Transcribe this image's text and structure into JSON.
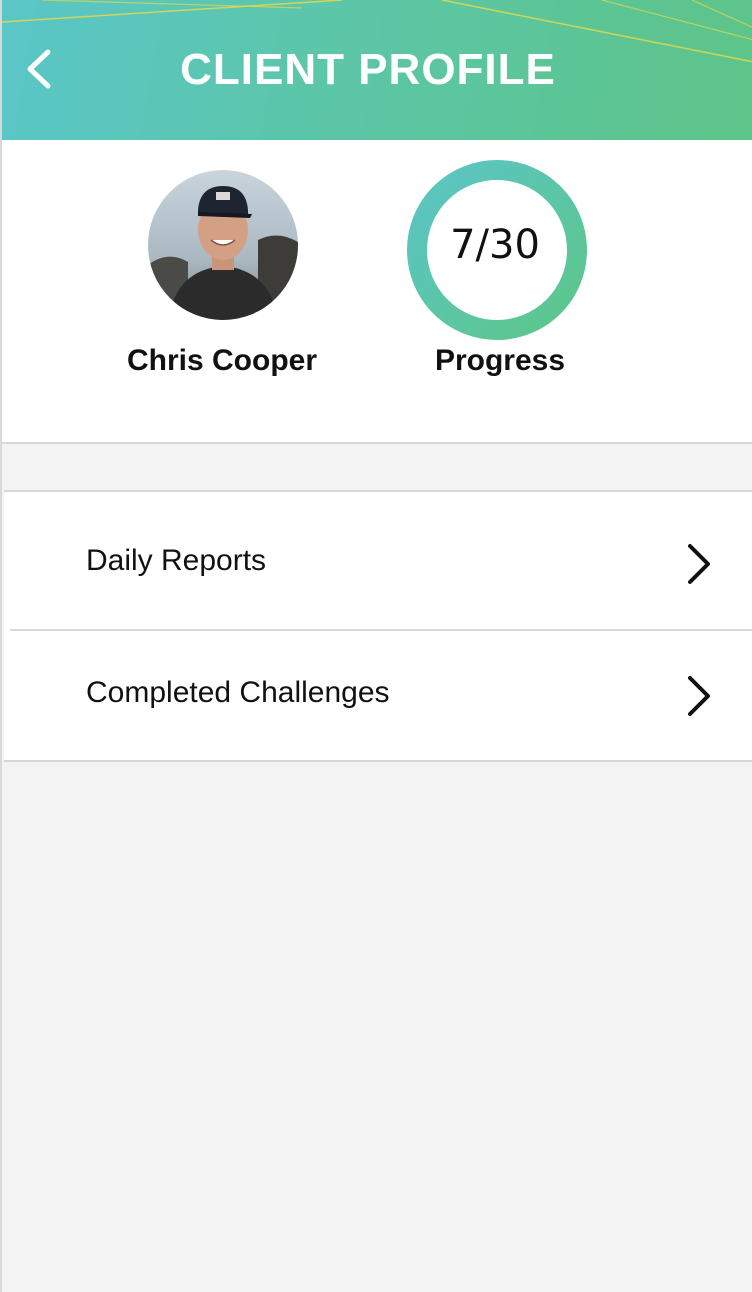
{
  "header": {
    "title": "CLIENT PROFILE",
    "back_icon": "chevron-left-icon"
  },
  "profile": {
    "name": "Chris Cooper",
    "progress_value": "7/30",
    "progress_label": "Progress",
    "progress_fraction": 1.0
  },
  "menu": {
    "items": [
      {
        "label": "Daily Reports",
        "icon": "chevron-right-icon"
      },
      {
        "label": "Completed Challenges",
        "icon": "chevron-right-icon"
      }
    ]
  },
  "colors": {
    "header_gradient_start": "#5ac6c8",
    "header_gradient_end": "#5dc489",
    "ring_start": "#5bc5c6",
    "ring_end": "#5cc689",
    "background": "#f3f3f3"
  }
}
